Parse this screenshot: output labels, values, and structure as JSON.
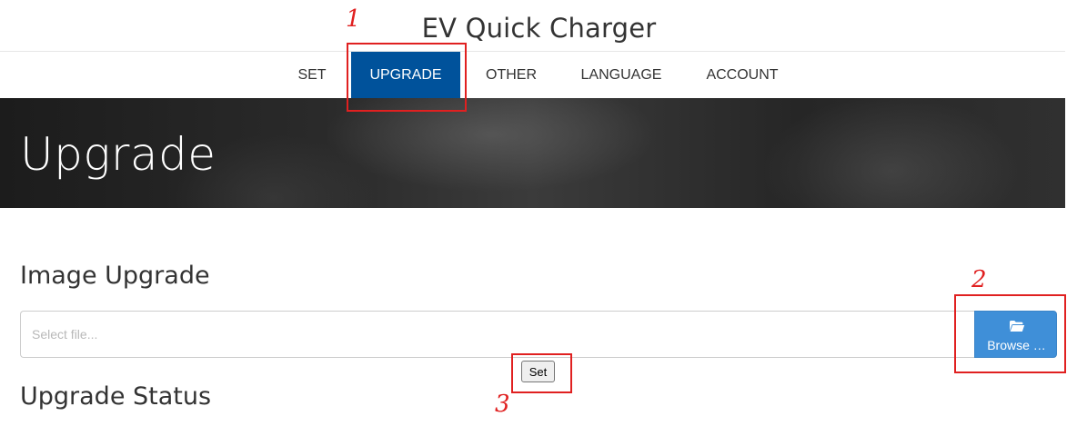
{
  "header": {
    "site_title": "EV Quick Charger"
  },
  "nav": {
    "items": [
      {
        "label": "SET",
        "active": false
      },
      {
        "label": "UPGRADE",
        "active": true
      },
      {
        "label": "OTHER",
        "active": false
      },
      {
        "label": "LANGUAGE",
        "active": false
      },
      {
        "label": "ACCOUNT",
        "active": false
      }
    ],
    "active_color": "#00529b"
  },
  "hero": {
    "title": "Upgrade"
  },
  "image_upgrade": {
    "heading": "Image Upgrade",
    "file_input": {
      "placeholder": "Select file...",
      "value": ""
    },
    "browse_button": {
      "label": "Browse …",
      "icon": "folder-open-icon",
      "color": "#3f8fd8"
    },
    "set_button": {
      "label": "Set"
    }
  },
  "upgrade_status": {
    "heading": "Upgrade Status"
  },
  "annotations": {
    "color": "#e02020",
    "markers": [
      "1",
      "2",
      "3"
    ]
  }
}
